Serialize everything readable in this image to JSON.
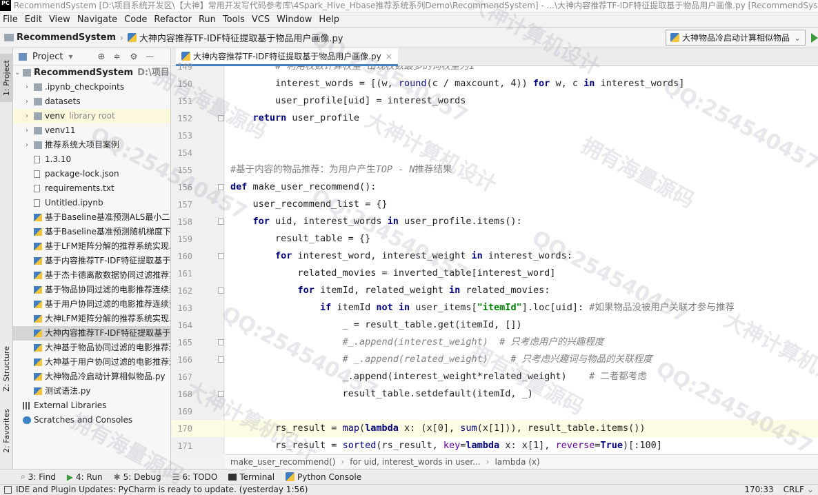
{
  "window": {
    "title": "RecommendSystem [D:\\项目系统开发区\\【大神】常用开发写代码参考库\\4Spark_Hive_Hbase推荐系统系列Demo\\RecommendSystem] - ...\\大神内容推荐TF-IDF特征提取基于物品用户画像.py [RecommendSystem]",
    "app_icon": "PC"
  },
  "menu": [
    "File",
    "Edit",
    "View",
    "Navigate",
    "Code",
    "Refactor",
    "Run",
    "Tools",
    "VCS",
    "Window",
    "Help"
  ],
  "nav": {
    "project": "RecommendSystem",
    "file": "大神内容推荐TF-IDF特征提取基于物品用户画像.py",
    "run_config": "大神物品冷启动计算相似物品"
  },
  "left_tools": {
    "project_tab": "1: Project",
    "structure_tab": "Z: Structure",
    "favorites_tab": "2: Favorites"
  },
  "project_panel": {
    "title": "Project",
    "items": [
      {
        "label": "RecommendSystem",
        "suffix": "D:\\项目系统开发",
        "type": "root"
      },
      {
        "label": ".ipynb_checkpoints",
        "type": "folder"
      },
      {
        "label": "datasets",
        "type": "folder"
      },
      {
        "label": "venv",
        "suffix": "library root",
        "type": "folder"
      },
      {
        "label": "venv11",
        "type": "folder"
      },
      {
        "label": "推荐系统大项目案例",
        "type": "folder"
      },
      {
        "label": "1.3.10",
        "type": "file"
      },
      {
        "label": "package-lock.json",
        "type": "file"
      },
      {
        "label": "requirements.txt",
        "type": "file"
      },
      {
        "label": "Untitled.ipynb",
        "type": "file"
      },
      {
        "label": "基于Baseline基准预测ALS最小二乘",
        "type": "py"
      },
      {
        "label": "基于Baseline基准预测随机梯度下降",
        "type": "py"
      },
      {
        "label": "基于LFM矩阵分解的推荐系统实现.p",
        "type": "py"
      },
      {
        "label": "基于内容推荐TF-IDF特征提取基于物",
        "type": "py"
      },
      {
        "label": "基于杰卡德离散数据协同过滤推荐算",
        "type": "py"
      },
      {
        "label": "基于物品协同过滤的电影推荐连续型",
        "type": "py"
      },
      {
        "label": "基于用户协同过滤的电影推荐连续型",
        "type": "py"
      },
      {
        "label": "大神LFM矩阵分解的推荐系统实现.py",
        "type": "py"
      },
      {
        "label": "大神内容推荐TF-IDF特征提取基于物",
        "type": "py"
      },
      {
        "label": "大神基于物品协同过滤的电影推荐连",
        "type": "py"
      },
      {
        "label": "大神基于用户协同过滤的电影推荐连",
        "type": "py"
      },
      {
        "label": "大神物品冷启动计算相似物品.py",
        "type": "py"
      },
      {
        "label": "测试语法.py",
        "type": "py"
      },
      {
        "label": "External Libraries",
        "type": "lib"
      },
      {
        "label": "Scratches and Consoles",
        "type": "scratch"
      }
    ]
  },
  "editor": {
    "tab": "大神内容推荐TF-IDF特征提取基于物品用户画像.py",
    "breadcrumb": [
      "make_user_recommend()",
      "for uid, interest_words in user...",
      "lambda (x)"
    ]
  },
  "bottom_tools": [
    "3: Find",
    "4: Run",
    "6: TODO",
    "Terminal",
    "Python Console",
    "5: Debug"
  ],
  "status": {
    "message": "IDE and Plugin Updates: PyCharm is ready to update. (yesterday 1:56)",
    "position": "170:33",
    "line_sep": "CRLF"
  },
  "watermarks": [
    "QQ:254540457",
    "大神计算机设计",
    "拥有海量源码"
  ]
}
